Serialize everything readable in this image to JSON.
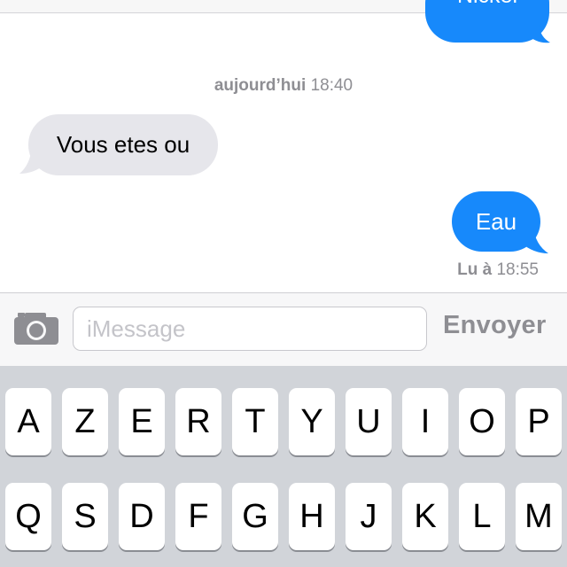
{
  "conversation": {
    "previous_message": "Nickel",
    "timestamp": {
      "day": "aujourd’hui",
      "time": "18:40"
    },
    "incoming_message": "Vous etes ou",
    "outgoing_message": "Eau",
    "read_receipt": {
      "label": "Lu à",
      "time": "18:55"
    }
  },
  "input_bar": {
    "placeholder": "iMessage",
    "send_label": "Envoyer"
  },
  "keyboard": {
    "row1": [
      "A",
      "Z",
      "E",
      "R",
      "T",
      "Y",
      "U",
      "I",
      "O",
      "P"
    ],
    "row2": [
      "Q",
      "S",
      "D",
      "F",
      "G",
      "H",
      "J",
      "K",
      "L",
      "M"
    ]
  },
  "colors": {
    "outgoing_bubble": "#1789fb",
    "incoming_bubble": "#e6e6eb",
    "keyboard_bg": "#d1d4d9",
    "secondary_text": "#8e8e93"
  }
}
